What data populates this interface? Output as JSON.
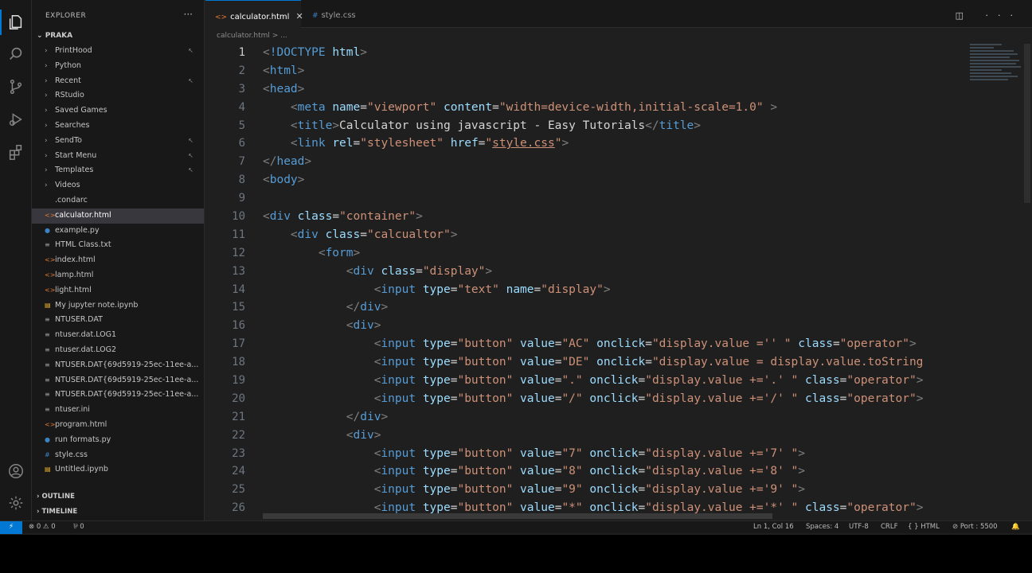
{
  "sidebar": {
    "title": "EXPLORER",
    "more": "···",
    "root": "PRAKA",
    "items": [
      {
        "label": "PrintHood",
        "type": "folder",
        "mark": "↖"
      },
      {
        "label": "Python",
        "type": "folder",
        "mark": ""
      },
      {
        "label": "Recent",
        "type": "folder",
        "mark": "↖"
      },
      {
        "label": "RStudio",
        "type": "folder",
        "mark": ""
      },
      {
        "label": "Saved Games",
        "type": "folder",
        "mark": ""
      },
      {
        "label": "Searches",
        "type": "folder",
        "mark": ""
      },
      {
        "label": "SendTo",
        "type": "folder",
        "mark": "↖"
      },
      {
        "label": "Start Menu",
        "type": "folder",
        "mark": "↖"
      },
      {
        "label": "Templates",
        "type": "folder",
        "mark": "↖"
      },
      {
        "label": "Videos",
        "type": "folder",
        "mark": ""
      },
      {
        "label": ".condarc",
        "type": "file",
        "icon": "",
        "color": "#9d9d9d"
      },
      {
        "label": "calculator.html",
        "type": "file",
        "icon": "<>",
        "color": "#e37933",
        "selected": true
      },
      {
        "label": "example.py",
        "type": "file",
        "icon": "●",
        "color": "#3b82c4"
      },
      {
        "label": "HTML Class.txt",
        "type": "file",
        "icon": "≡",
        "color": "#9d9d9d"
      },
      {
        "label": "index.html",
        "type": "file",
        "icon": "<>",
        "color": "#e37933"
      },
      {
        "label": "lamp.html",
        "type": "file",
        "icon": "<>",
        "color": "#e37933"
      },
      {
        "label": "light.html",
        "type": "file",
        "icon": "<>",
        "color": "#e37933"
      },
      {
        "label": "My jupyter note.ipynb",
        "type": "file",
        "icon": "▤",
        "color": "#f0b428"
      },
      {
        "label": "NTUSER.DAT",
        "type": "file",
        "icon": "≡",
        "color": "#9d9d9d"
      },
      {
        "label": "ntuser.dat.LOG1",
        "type": "file",
        "icon": "≡",
        "color": "#9d9d9d"
      },
      {
        "label": "ntuser.dat.LOG2",
        "type": "file",
        "icon": "≡",
        "color": "#9d9d9d"
      },
      {
        "label": "NTUSER.DAT{69d5919-25ec-11ee-a...",
        "type": "file",
        "icon": "≡",
        "color": "#9d9d9d"
      },
      {
        "label": "NTUSER.DAT{69d5919-25ec-11ee-a...",
        "type": "file",
        "icon": "≡",
        "color": "#9d9d9d"
      },
      {
        "label": "NTUSER.DAT{69d5919-25ec-11ee-a...",
        "type": "file",
        "icon": "≡",
        "color": "#9d9d9d"
      },
      {
        "label": "ntuser.ini",
        "type": "file",
        "icon": "≡",
        "color": "#9d9d9d"
      },
      {
        "label": "program.html",
        "type": "file",
        "icon": "<>",
        "color": "#e37933"
      },
      {
        "label": "run formats.py",
        "type": "file",
        "icon": "●",
        "color": "#3b82c4"
      },
      {
        "label": "style.css",
        "type": "file",
        "icon": "#",
        "color": "#3b82c4"
      },
      {
        "label": "Untitled.ipynb",
        "type": "file",
        "icon": "▤",
        "color": "#f0b428"
      }
    ],
    "outline": "OUTLINE",
    "timeline": "TIMELINE"
  },
  "tabs": [
    {
      "label": "calculator.html",
      "icon": "<>",
      "active": true,
      "close": "✕"
    },
    {
      "label": "style.css",
      "icon": "#",
      "active": false,
      "close": ""
    }
  ],
  "editor_actions": "◫ ···",
  "breadcrumb": "calculator.html > ...",
  "code_lines": [
    {
      "n": "1",
      "tokens": [
        [
          "br",
          "<"
        ],
        [
          "tag",
          "!DOCTYPE"
        ],
        [
          "text",
          " "
        ],
        [
          "attr",
          "html"
        ],
        [
          "br",
          ">"
        ]
      ]
    },
    {
      "n": "2",
      "tokens": [
        [
          "br",
          "<"
        ],
        [
          "tag",
          "html"
        ],
        [
          "br",
          ">"
        ]
      ]
    },
    {
      "n": "3",
      "tokens": [
        [
          "br",
          "<"
        ],
        [
          "tag",
          "head"
        ],
        [
          "br",
          ">"
        ]
      ]
    },
    {
      "n": "4",
      "tokens": [
        [
          "text",
          "    "
        ],
        [
          "br",
          "<"
        ],
        [
          "tag",
          "meta"
        ],
        [
          "text",
          " "
        ],
        [
          "attr",
          "name"
        ],
        [
          "text",
          "="
        ],
        [
          "str",
          "\"viewport\""
        ],
        [
          "text",
          " "
        ],
        [
          "attr",
          "content"
        ],
        [
          "text",
          "="
        ],
        [
          "str",
          "\"width=device-width,initial-scale=1.0\""
        ],
        [
          "text",
          " "
        ],
        [
          "br",
          ">"
        ]
      ]
    },
    {
      "n": "5",
      "tokens": [
        [
          "text",
          "    "
        ],
        [
          "br",
          "<"
        ],
        [
          "tag",
          "title"
        ],
        [
          "br",
          ">"
        ],
        [
          "text",
          "Calculator using javascript - Easy Tutorials"
        ],
        [
          "br",
          "</"
        ],
        [
          "tag",
          "title"
        ],
        [
          "br",
          ">"
        ]
      ]
    },
    {
      "n": "6",
      "tokens": [
        [
          "text",
          "    "
        ],
        [
          "br",
          "<"
        ],
        [
          "tag",
          "link"
        ],
        [
          "text",
          " "
        ],
        [
          "attr",
          "rel"
        ],
        [
          "text",
          "="
        ],
        [
          "str",
          "\"stylesheet\""
        ],
        [
          "text",
          " "
        ],
        [
          "attr",
          "href"
        ],
        [
          "text",
          "="
        ],
        [
          "str",
          "\""
        ],
        [
          "link",
          "style.css"
        ],
        [
          "str",
          "\""
        ],
        [
          "br",
          ">"
        ]
      ]
    },
    {
      "n": "7",
      "tokens": [
        [
          "br",
          "</"
        ],
        [
          "tag",
          "head"
        ],
        [
          "br",
          ">"
        ]
      ]
    },
    {
      "n": "8",
      "tokens": [
        [
          "br",
          "<"
        ],
        [
          "tag",
          "body"
        ],
        [
          "br",
          ">"
        ]
      ]
    },
    {
      "n": "9",
      "tokens": []
    },
    {
      "n": "10",
      "tokens": [
        [
          "br",
          "<"
        ],
        [
          "tag",
          "div"
        ],
        [
          "text",
          " "
        ],
        [
          "attr",
          "class"
        ],
        [
          "text",
          "="
        ],
        [
          "str",
          "\"container\""
        ],
        [
          "br",
          ">"
        ]
      ]
    },
    {
      "n": "11",
      "tokens": [
        [
          "text",
          "    "
        ],
        [
          "br",
          "<"
        ],
        [
          "tag",
          "div"
        ],
        [
          "text",
          " "
        ],
        [
          "attr",
          "class"
        ],
        [
          "text",
          "="
        ],
        [
          "str",
          "\"calcualtor\""
        ],
        [
          "br",
          ">"
        ]
      ]
    },
    {
      "n": "12",
      "tokens": [
        [
          "text",
          "        "
        ],
        [
          "br",
          "<"
        ],
        [
          "tag",
          "form"
        ],
        [
          "br",
          ">"
        ]
      ]
    },
    {
      "n": "13",
      "tokens": [
        [
          "text",
          "            "
        ],
        [
          "br",
          "<"
        ],
        [
          "tag",
          "div"
        ],
        [
          "text",
          " "
        ],
        [
          "attr",
          "class"
        ],
        [
          "text",
          "="
        ],
        [
          "str",
          "\"display\""
        ],
        [
          "br",
          ">"
        ]
      ]
    },
    {
      "n": "14",
      "tokens": [
        [
          "text",
          "                "
        ],
        [
          "br",
          "<"
        ],
        [
          "tag",
          "input"
        ],
        [
          "text",
          " "
        ],
        [
          "attr",
          "type"
        ],
        [
          "text",
          "="
        ],
        [
          "str",
          "\"text\""
        ],
        [
          "text",
          " "
        ],
        [
          "attr",
          "name"
        ],
        [
          "text",
          "="
        ],
        [
          "str",
          "\"display\""
        ],
        [
          "br",
          ">"
        ]
      ]
    },
    {
      "n": "15",
      "tokens": [
        [
          "text",
          "            "
        ],
        [
          "br",
          "</"
        ],
        [
          "tag",
          "div"
        ],
        [
          "br",
          ">"
        ]
      ]
    },
    {
      "n": "16",
      "tokens": [
        [
          "text",
          "            "
        ],
        [
          "br",
          "<"
        ],
        [
          "tag",
          "div"
        ],
        [
          "br",
          ">"
        ]
      ]
    },
    {
      "n": "17",
      "tokens": [
        [
          "text",
          "                "
        ],
        [
          "br",
          "<"
        ],
        [
          "tag",
          "input"
        ],
        [
          "text",
          " "
        ],
        [
          "attr",
          "type"
        ],
        [
          "text",
          "="
        ],
        [
          "str",
          "\"button\""
        ],
        [
          "text",
          " "
        ],
        [
          "attr",
          "value"
        ],
        [
          "text",
          "="
        ],
        [
          "str",
          "\"AC\""
        ],
        [
          "text",
          " "
        ],
        [
          "attr",
          "onclick"
        ],
        [
          "text",
          "="
        ],
        [
          "str",
          "\"display.value ='' \""
        ],
        [
          "text",
          " "
        ],
        [
          "attr",
          "class"
        ],
        [
          "text",
          "="
        ],
        [
          "str",
          "\"operator\""
        ],
        [
          "br",
          ">"
        ]
      ]
    },
    {
      "n": "18",
      "tokens": [
        [
          "text",
          "                "
        ],
        [
          "br",
          "<"
        ],
        [
          "tag",
          "input"
        ],
        [
          "text",
          " "
        ],
        [
          "attr",
          "type"
        ],
        [
          "text",
          "="
        ],
        [
          "str",
          "\"button\""
        ],
        [
          "text",
          " "
        ],
        [
          "attr",
          "value"
        ],
        [
          "text",
          "="
        ],
        [
          "str",
          "\"DE\""
        ],
        [
          "text",
          " "
        ],
        [
          "attr",
          "onclick"
        ],
        [
          "text",
          "="
        ],
        [
          "str",
          "\"display.value = display.value.toString"
        ]
      ]
    },
    {
      "n": "19",
      "tokens": [
        [
          "text",
          "                "
        ],
        [
          "br",
          "<"
        ],
        [
          "tag",
          "input"
        ],
        [
          "text",
          " "
        ],
        [
          "attr",
          "type"
        ],
        [
          "text",
          "="
        ],
        [
          "str",
          "\"button\""
        ],
        [
          "text",
          " "
        ],
        [
          "attr",
          "value"
        ],
        [
          "text",
          "="
        ],
        [
          "str",
          "\".\""
        ],
        [
          "text",
          " "
        ],
        [
          "attr",
          "onclick"
        ],
        [
          "text",
          "="
        ],
        [
          "str",
          "\"display.value +='.' \""
        ],
        [
          "text",
          " "
        ],
        [
          "attr",
          "class"
        ],
        [
          "text",
          "="
        ],
        [
          "str",
          "\"operator\""
        ],
        [
          "br",
          ">"
        ]
      ]
    },
    {
      "n": "20",
      "tokens": [
        [
          "text",
          "                "
        ],
        [
          "br",
          "<"
        ],
        [
          "tag",
          "input"
        ],
        [
          "text",
          " "
        ],
        [
          "attr",
          "type"
        ],
        [
          "text",
          "="
        ],
        [
          "str",
          "\"button\""
        ],
        [
          "text",
          " "
        ],
        [
          "attr",
          "value"
        ],
        [
          "text",
          "="
        ],
        [
          "str",
          "\"/\""
        ],
        [
          "text",
          " "
        ],
        [
          "attr",
          "onclick"
        ],
        [
          "text",
          "="
        ],
        [
          "str",
          "\"display.value +='/' \""
        ],
        [
          "text",
          " "
        ],
        [
          "attr",
          "class"
        ],
        [
          "text",
          "="
        ],
        [
          "str",
          "\"operator\""
        ],
        [
          "br",
          ">"
        ]
      ]
    },
    {
      "n": "21",
      "tokens": [
        [
          "text",
          "            "
        ],
        [
          "br",
          "</"
        ],
        [
          "tag",
          "div"
        ],
        [
          "br",
          ">"
        ]
      ]
    },
    {
      "n": "22",
      "tokens": [
        [
          "text",
          "            "
        ],
        [
          "br",
          "<"
        ],
        [
          "tag",
          "div"
        ],
        [
          "br",
          ">"
        ]
      ]
    },
    {
      "n": "23",
      "tokens": [
        [
          "text",
          "                "
        ],
        [
          "br",
          "<"
        ],
        [
          "tag",
          "input"
        ],
        [
          "text",
          " "
        ],
        [
          "attr",
          "type"
        ],
        [
          "text",
          "="
        ],
        [
          "str",
          "\"button\""
        ],
        [
          "text",
          " "
        ],
        [
          "attr",
          "value"
        ],
        [
          "text",
          "="
        ],
        [
          "str",
          "\"7\""
        ],
        [
          "text",
          " "
        ],
        [
          "attr",
          "onclick"
        ],
        [
          "text",
          "="
        ],
        [
          "str",
          "\"display.value +='7' \""
        ],
        [
          "br",
          ">"
        ]
      ]
    },
    {
      "n": "24",
      "tokens": [
        [
          "text",
          "                "
        ],
        [
          "br",
          "<"
        ],
        [
          "tag",
          "input"
        ],
        [
          "text",
          " "
        ],
        [
          "attr",
          "type"
        ],
        [
          "text",
          "="
        ],
        [
          "str",
          "\"button\""
        ],
        [
          "text",
          " "
        ],
        [
          "attr",
          "value"
        ],
        [
          "text",
          "="
        ],
        [
          "str",
          "\"8\""
        ],
        [
          "text",
          " "
        ],
        [
          "attr",
          "onclick"
        ],
        [
          "text",
          "="
        ],
        [
          "str",
          "\"display.value +='8' \""
        ],
        [
          "br",
          ">"
        ]
      ]
    },
    {
      "n": "25",
      "tokens": [
        [
          "text",
          "                "
        ],
        [
          "br",
          "<"
        ],
        [
          "tag",
          "input"
        ],
        [
          "text",
          " "
        ],
        [
          "attr",
          "type"
        ],
        [
          "text",
          "="
        ],
        [
          "str",
          "\"button\""
        ],
        [
          "text",
          " "
        ],
        [
          "attr",
          "value"
        ],
        [
          "text",
          "="
        ],
        [
          "str",
          "\"9\""
        ],
        [
          "text",
          " "
        ],
        [
          "attr",
          "onclick"
        ],
        [
          "text",
          "="
        ],
        [
          "str",
          "\"display.value +='9' \""
        ],
        [
          "br",
          ">"
        ]
      ]
    },
    {
      "n": "26",
      "tokens": [
        [
          "text",
          "                "
        ],
        [
          "br",
          "<"
        ],
        [
          "tag",
          "input"
        ],
        [
          "text",
          " "
        ],
        [
          "attr",
          "type"
        ],
        [
          "text",
          "="
        ],
        [
          "str",
          "\"button\""
        ],
        [
          "text",
          " "
        ],
        [
          "attr",
          "value"
        ],
        [
          "text",
          "="
        ],
        [
          "str",
          "\"*\""
        ],
        [
          "text",
          " "
        ],
        [
          "attr",
          "onclick"
        ],
        [
          "text",
          "="
        ],
        [
          "str",
          "\"display.value +='*' \""
        ],
        [
          "text",
          " "
        ],
        [
          "attr",
          "class"
        ],
        [
          "text",
          "="
        ],
        [
          "str",
          "\"operator\""
        ],
        [
          "br",
          ">"
        ]
      ]
    }
  ],
  "status": {
    "remote": "⚡",
    "problems": "⊗ 0 ⚠ 0",
    "ports": "⅌ 0",
    "position": "Ln 1, Col 16",
    "spaces": "Spaces: 4",
    "encoding": "UTF-8",
    "eol": "CRLF",
    "language": "{ } HTML",
    "port": "⊘ Port : 5500",
    "bell": "🔔"
  },
  "colors": {
    "accent": "#0078d4",
    "tag": "#569cd6",
    "attr": "#9cdcfe",
    "string": "#ce9178"
  }
}
